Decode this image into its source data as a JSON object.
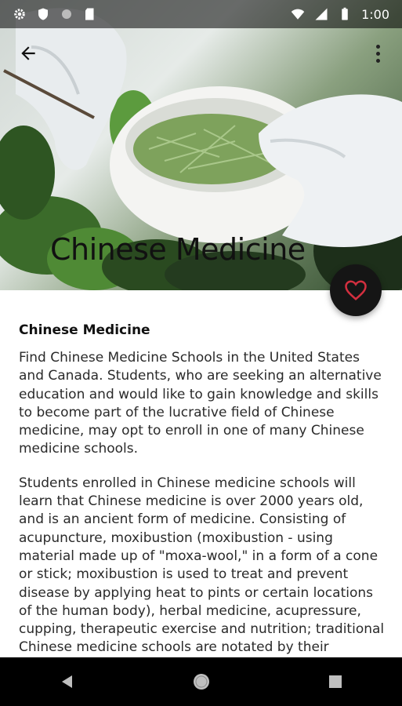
{
  "status_bar": {
    "time": "1:00",
    "left_icons": [
      "gear-icon",
      "shield-icon",
      "circle-icon",
      "sd-card-icon"
    ],
    "right_icons": [
      "wifi-icon",
      "signal-icon",
      "battery-icon"
    ]
  },
  "header": {
    "hero_title": "Chinese Medicine",
    "back_icon": "arrow-back-icon",
    "menu_icon": "more-vert-icon"
  },
  "fab": {
    "icon": "heart-outline-icon",
    "color": "#d32f3f"
  },
  "article": {
    "title": "Chinese Medicine",
    "paragraphs": [
      "Find Chinese Medicine Schools in the United States and Canada. Students, who are seeking an alternative education and would like to gain knowledge and skills to become part of the lucrative field of Chinese medicine, may opt to enroll in one of many Chinese medicine schools.",
      "Students enrolled in Chinese medicine schools will learn that Chinese medicine is over 2000 years old, and is an ancient form of medicine. Consisting of acupuncture, moxibustion (moxibustion - using material made up of \"moxa-wool,\" in a form of a cone or stick; moxibustion is used to treat and prevent disease by applying heat to pints or certain locations of the human body), herbal medicine, acupressure, cupping, therapeutic exercise and nutrition; traditional Chinese medicine schools are notated by their principle teachings of internal balance and harmony"
    ]
  },
  "nav_bar": {
    "buttons": [
      "back-triangle-icon",
      "home-circle-icon",
      "recents-square-icon"
    ]
  }
}
